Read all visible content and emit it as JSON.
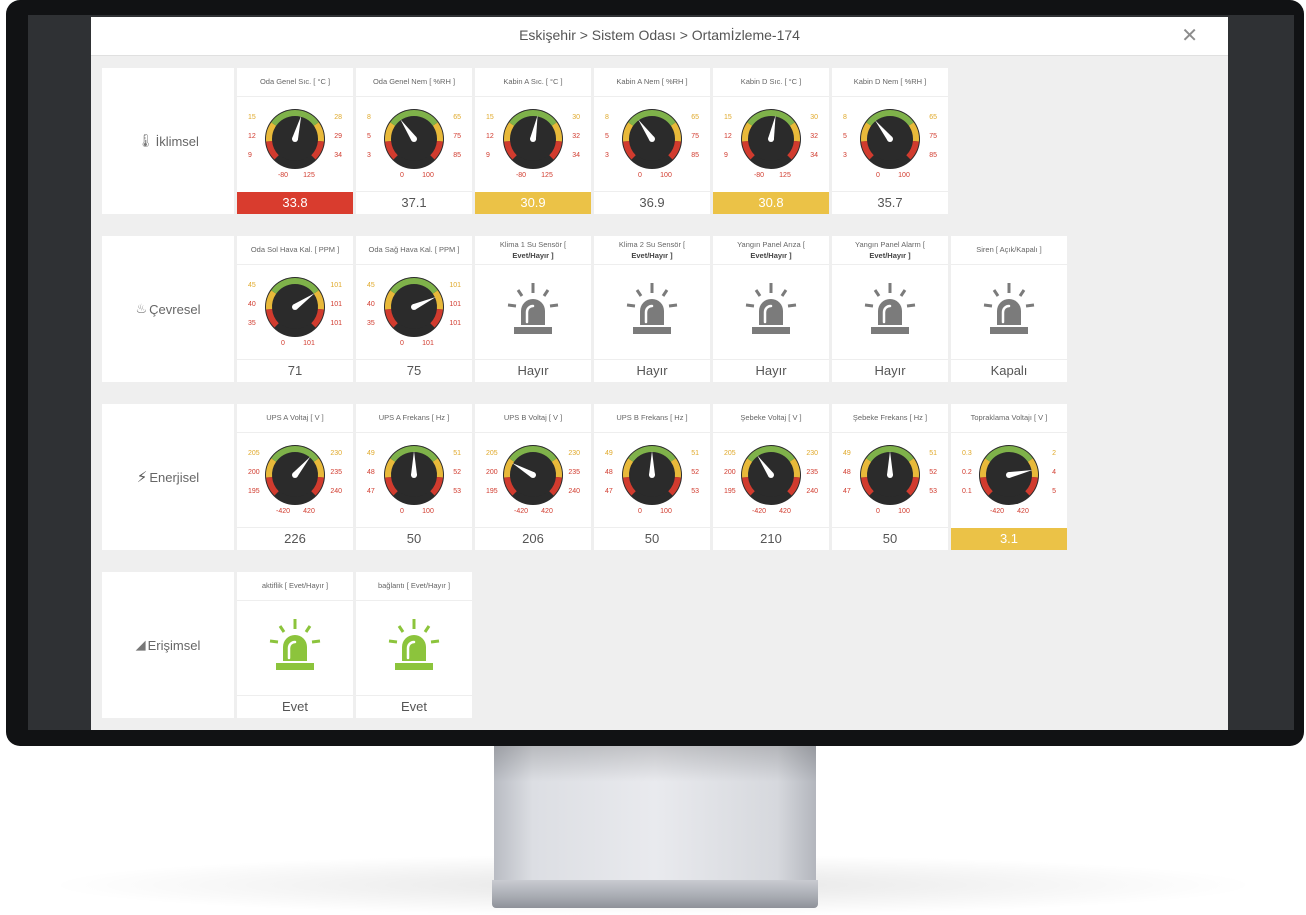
{
  "header": {
    "breadcrumb": "Eskişehir > Sistem Odası > Ortamİzleme-174",
    "close_icon": "close-icon"
  },
  "colors": {
    "alert_red": "#d93c2e",
    "alert_yellow": "#ebc247",
    "siren_gray": "#7b7b7b",
    "siren_green": "#8cc43c"
  },
  "sections": [
    {
      "label": "İklimsel",
      "icon": "thermometer-icon",
      "tiles": [
        {
          "type": "gauge",
          "title": "Oda Genel Sıc. [ °C ]",
          "labels": {
            "min_inner": "9",
            "low": "12",
            "low_warn": "15",
            "high_warn": "28",
            "high": "29",
            "max_inner": "34",
            "range_min": "-80",
            "range_max": "125"
          },
          "value": 33.8,
          "value_text": "33.8",
          "status": "red"
        },
        {
          "type": "gauge",
          "title": "Oda Genel Nem [ %RH ]",
          "labels": {
            "min_inner": "3",
            "low": "5",
            "low_warn": "8",
            "high_warn": "65",
            "high": "75",
            "max_inner": "85",
            "range_min": "0",
            "range_max": "100"
          },
          "value": 37.1,
          "value_text": "37.1",
          "status": "normal"
        },
        {
          "type": "gauge",
          "title": "Kabin A Sıc. [ °C ]",
          "labels": {
            "min_inner": "9",
            "low": "12",
            "low_warn": "15",
            "high_warn": "30",
            "high": "32",
            "max_inner": "34",
            "range_min": "-80",
            "range_max": "125"
          },
          "value": 30.9,
          "value_text": "30.9",
          "status": "yellow"
        },
        {
          "type": "gauge",
          "title": "Kabin A Nem [ %RH ]",
          "labels": {
            "min_inner": "3",
            "low": "5",
            "low_warn": "8",
            "high_warn": "65",
            "high": "75",
            "max_inner": "85",
            "range_min": "0",
            "range_max": "100"
          },
          "value": 36.9,
          "value_text": "36.9",
          "status": "normal"
        },
        {
          "type": "gauge",
          "title": "Kabin D Sıc. [ °C ]",
          "labels": {
            "min_inner": "9",
            "low": "12",
            "low_warn": "15",
            "high_warn": "30",
            "high": "32",
            "max_inner": "34",
            "range_min": "-80",
            "range_max": "125"
          },
          "value": 30.8,
          "value_text": "30.8",
          "status": "yellow"
        },
        {
          "type": "gauge",
          "title": "Kabin D Nem [ %RH ]",
          "labels": {
            "min_inner": "3",
            "low": "5",
            "low_warn": "8",
            "high_warn": "65",
            "high": "75",
            "max_inner": "85",
            "range_min": "0",
            "range_max": "100"
          },
          "value": 35.7,
          "value_text": "35.7",
          "status": "normal"
        }
      ]
    },
    {
      "label": "Çevresel",
      "icon": "environment-icon",
      "tiles": [
        {
          "type": "gauge",
          "title": "Oda Sol Hava Kal. [ PPM ]",
          "labels": {
            "min_inner": "35",
            "low": "40",
            "low_warn": "45",
            "high_warn": "101",
            "high": "101",
            "max_inner": "101",
            "range_min": "0",
            "range_max": "101"
          },
          "value": 71,
          "value_text": "71",
          "status": "normal"
        },
        {
          "type": "gauge",
          "title": "Oda Sağ Hava Kal. [ PPM ]",
          "labels": {
            "min_inner": "35",
            "low": "40",
            "low_warn": "45",
            "high_warn": "101",
            "high": "101",
            "max_inner": "101",
            "range_min": "0",
            "range_max": "101"
          },
          "value": 75,
          "value_text": "75",
          "status": "normal"
        },
        {
          "type": "siren",
          "title": "Klima 1 Su Sensör [",
          "title2": "Evet/Hayır ]",
          "state": "off",
          "value_text": "Hayır"
        },
        {
          "type": "siren",
          "title": "Klima 2 Su Sensör [",
          "title2": "Evet/Hayır ]",
          "state": "off",
          "value_text": "Hayır"
        },
        {
          "type": "siren",
          "title": "Yangın Panel Arıza [",
          "title2": "Evet/Hayır ]",
          "state": "off",
          "value_text": "Hayır"
        },
        {
          "type": "siren",
          "title": "Yangın Panel Alarm [",
          "title2": "Evet/Hayır ]",
          "state": "off",
          "value_text": "Hayır"
        },
        {
          "type": "siren",
          "title": "Siren [ Açık/Kapalı ]",
          "state": "off",
          "value_text": "Kapalı"
        }
      ]
    },
    {
      "label": "Enerjisel",
      "icon": "bolt-icon",
      "tiles": [
        {
          "type": "gauge",
          "title": "UPS A Voltaj [ V ]",
          "labels": {
            "min_inner": "195",
            "low": "200",
            "low_warn": "205",
            "high_warn": "230",
            "high": "235",
            "max_inner": "240",
            "range_min": "-420",
            "range_max": "420"
          },
          "value": 226,
          "value_text": "226",
          "status": "normal",
          "angle": 40
        },
        {
          "type": "gauge",
          "title": "UPS A Frekans [ Hz ]",
          "labels": {
            "min_inner": "47",
            "low": "48",
            "low_warn": "49",
            "high_warn": "51",
            "high": "52",
            "max_inner": "53",
            "range_min": "0",
            "range_max": "100"
          },
          "value": 50,
          "value_text": "50",
          "status": "normal"
        },
        {
          "type": "gauge",
          "title": "UPS B Voltaj [ V ]",
          "labels": {
            "min_inner": "195",
            "low": "200",
            "low_warn": "205",
            "high_warn": "230",
            "high": "235",
            "max_inner": "240",
            "range_min": "-420",
            "range_max": "420"
          },
          "value": 206,
          "value_text": "206",
          "status": "normal",
          "angle": -60
        },
        {
          "type": "gauge",
          "title": "UPS B Frekans [ Hz ]",
          "labels": {
            "min_inner": "47",
            "low": "48",
            "low_warn": "49",
            "high_warn": "51",
            "high": "52",
            "max_inner": "53",
            "range_min": "0",
            "range_max": "100"
          },
          "value": 50,
          "value_text": "50",
          "status": "normal"
        },
        {
          "type": "gauge",
          "title": "Şebeke Voltaj [ V ]",
          "labels": {
            "min_inner": "195",
            "low": "200",
            "low_warn": "205",
            "high_warn": "230",
            "high": "235",
            "max_inner": "240",
            "range_min": "-420",
            "range_max": "420"
          },
          "value": 210,
          "value_text": "210",
          "status": "normal",
          "angle": -35
        },
        {
          "type": "gauge",
          "title": "Şebeke Frekans [ Hz ]",
          "labels": {
            "min_inner": "47",
            "low": "48",
            "low_warn": "49",
            "high_warn": "51",
            "high": "52",
            "max_inner": "53",
            "range_min": "0",
            "range_max": "100"
          },
          "value": 50,
          "value_text": "50",
          "status": "normal"
        },
        {
          "type": "gauge",
          "title": "Topraklama Voltajı [ V ]",
          "labels": {
            "min_inner": "0.1",
            "low": "0.2",
            "low_warn": "0.3",
            "high_warn": "2",
            "high": "4",
            "max_inner": "5",
            "range_min": "-420",
            "range_max": "420"
          },
          "value": 3.1,
          "value_text": "3.1",
          "status": "yellow",
          "angle": 78
        }
      ]
    },
    {
      "label": "Erişimsel",
      "icon": "access-icon",
      "tiles": [
        {
          "type": "siren",
          "title": "aktiflik [ Evet/Hayır ]",
          "state": "on",
          "value_text": "Evet"
        },
        {
          "type": "siren",
          "title": "bağlantı [ Evet/Hayır ]",
          "state": "on",
          "value_text": "Evet"
        }
      ]
    }
  ]
}
